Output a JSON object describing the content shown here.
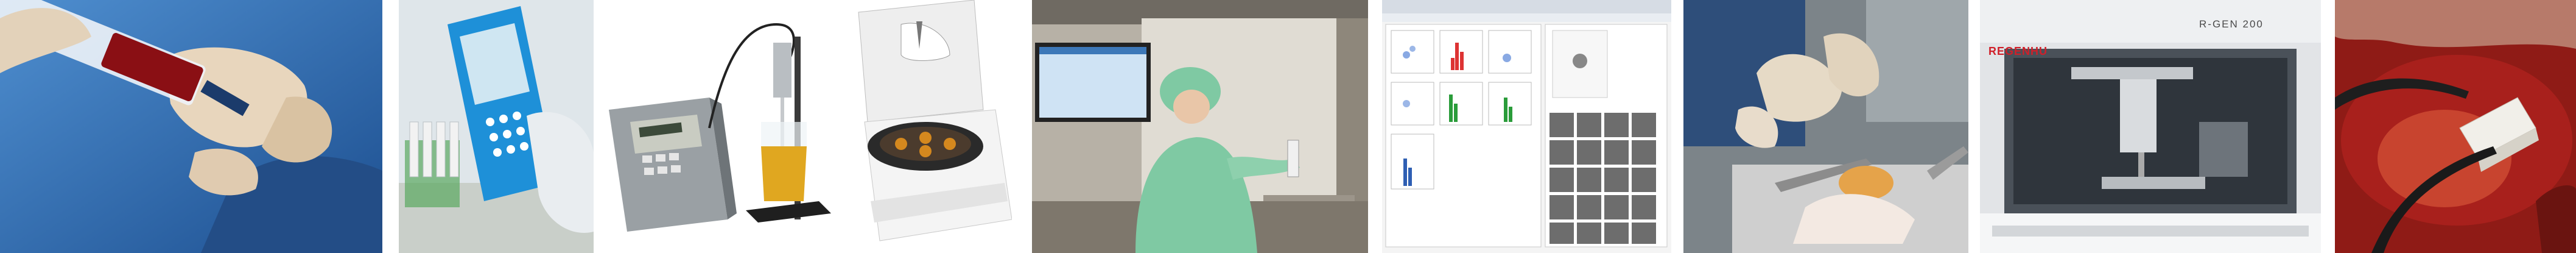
{
  "strip": {
    "panels": [
      {
        "id": "syringe-aspiration",
        "subject": "gloved hands drawing blood into a syringe"
      },
      {
        "id": "handheld-cell-counter",
        "subject": "gloved hand holding a blue handheld cell counter"
      },
      {
        "id": "sonicator",
        "subject": "ultrasonic processor with probe in a beaker"
      },
      {
        "id": "centrifuge",
        "subject": "benchtop centrifuge with open lid"
      },
      {
        "id": "cleanroom-hood",
        "subject": "operator in green gown working at a safety cabinet"
      },
      {
        "id": "analysis-software",
        "subject": "flow cytometry plots and cell image gallery on screen"
      },
      {
        "id": "tissue-preparation",
        "subject": "surgeon's gloved hands preparing a tissue sample"
      },
      {
        "id": "bioprinter",
        "subject": "REGENHU R-GEN 200 bioprinter"
      },
      {
        "id": "surgical-implant",
        "subject": "white scaffold implant in surgical site"
      }
    ]
  },
  "bioprinter": {
    "brand": "REGENHU",
    "model": "R-GEN 200"
  },
  "colors": {
    "surgical-blue": "#2f6fb5",
    "counter-blue": "#1e90d8",
    "cleanroom-green": "#7fc9a3",
    "tissue-red": "#a8201c"
  }
}
